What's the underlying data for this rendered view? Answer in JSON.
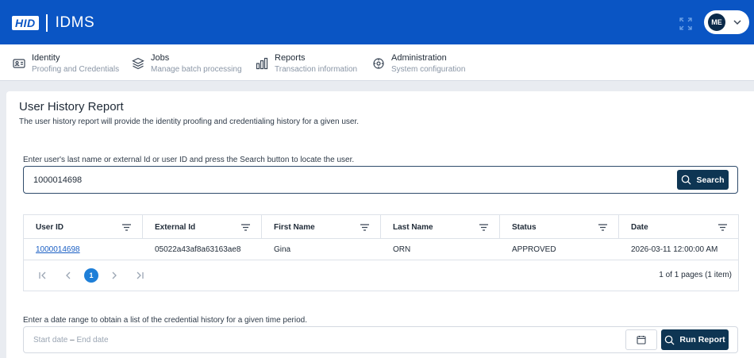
{
  "header": {
    "logo_badge": "HID",
    "app_name": "IDMS",
    "user_initials": "ME",
    "colors": {
      "brand": "#0a55c4",
      "avatar": "#0b2a4a"
    }
  },
  "nav": {
    "items": [
      {
        "title": "Identity",
        "subtitle": "Proofing and Credentials",
        "icon": "id-card-icon"
      },
      {
        "title": "Jobs",
        "subtitle": "Manage batch processing",
        "icon": "stack-icon"
      },
      {
        "title": "Reports",
        "subtitle": "Transaction information",
        "icon": "bar-chart-icon"
      },
      {
        "title": "Administration",
        "subtitle": "System configuration",
        "icon": "gear-icon"
      }
    ]
  },
  "page": {
    "title": "User History Report",
    "description": "The user history report will provide the identity proofing and credentialing history for a given user."
  },
  "search": {
    "label": "Enter user's last name or external Id or user ID and press the Search button to locate the user.",
    "value": "1000014698",
    "button_label": "Search"
  },
  "grid": {
    "columns": [
      "User ID",
      "External Id",
      "First Name",
      "Last Name",
      "Status",
      "Date"
    ],
    "rows": [
      {
        "user_id": "1000014698",
        "external_id": "05022a43af8a63163ae8",
        "first_name": "Gina",
        "last_name": "ORN",
        "status": "APPROVED",
        "date": "2026-03-11 12:00:00 AM"
      }
    ],
    "pager": {
      "current_page": "1",
      "info": "1 of 1 pages (1 item)"
    }
  },
  "date_range": {
    "label": "Enter a date range to obtain a list of the credential history for a given time period.",
    "start_placeholder": "Start date",
    "separator": "–",
    "end_placeholder": "End date",
    "button_label": "Run Report"
  }
}
